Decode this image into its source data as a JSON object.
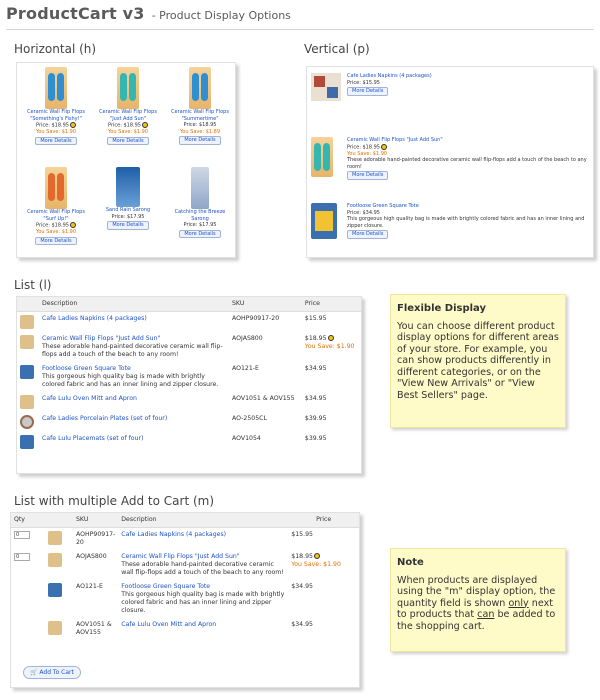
{
  "header": {
    "title": "ProductCart v3",
    "subtitle": "- Product Display Options"
  },
  "sections": {
    "horizontal": "Horizontal (h)",
    "vertical": "Vertical (p)",
    "list": "List (l)",
    "multi": "List with multiple Add to Cart (m)"
  },
  "horizontal": {
    "items": [
      {
        "name": "Ceramic Wall Flip Flops \"Something's Fishy!\"",
        "price": "Price: $18.95",
        "save": "You Save: $1.90",
        "more": "More Details"
      },
      {
        "name": "Ceramic Wall Flip Flops \"Just Add Sun\"",
        "price": "Price: $18.95",
        "save": "You Save: $1.90",
        "more": "More Details"
      },
      {
        "name": "Ceramic Wall Flip Flops \"Summertime\"",
        "price": "Price: $18.95",
        "save": "You Save: $1.89",
        "more": "More Details"
      },
      {
        "name": "Ceramic Wall Flip Flops \"Surf Up!\"",
        "price": "Price: $18.95",
        "save": "You Save: $1.90",
        "more": "More Details"
      },
      {
        "name": "Sand Rain Sarong",
        "price": "Price: $17.95",
        "save": "",
        "more": "More Details"
      },
      {
        "name": "Catching the Breeze Sarong",
        "price": "Price: $17.95",
        "save": "",
        "more": "More Details"
      }
    ]
  },
  "vertical": {
    "items": [
      {
        "name": "Cafe Ladies Napkins (4 packages)",
        "price": "Price: $15.95",
        "save": "",
        "desc": "",
        "more": "More Details"
      },
      {
        "name": "Ceramic Wall Flip Flops \"Just Add Sun\"",
        "price": "Price: $18.95",
        "save": "You Save: $1.90",
        "desc": "These adorable hand-painted decorative ceramic wall flip-flops add a touch of the beach to any room!",
        "more": "More Details"
      },
      {
        "name": "Footloose Green Square Tote",
        "price": "Price: $34.95",
        "save": "",
        "desc": "This gorgeous high quality bag is made with brightly colored fabric and has an inner lining and zipper closure.",
        "more": "More Details"
      }
    ]
  },
  "list": {
    "headers": {
      "description": "Description",
      "sku": "SKU",
      "price": "Price"
    },
    "rows": [
      {
        "name": "Cafe Ladies Napkins (4 packages)",
        "desc": "",
        "sku": "AOHP90917-20",
        "price": "$15.95",
        "save": ""
      },
      {
        "name": "Ceramic Wall Flip Flops \"Just Add Sun\"",
        "desc": "These adorable hand-painted decorative ceramic wall flip-flops add a touch of the beach to any room!",
        "sku": "AOJAS800",
        "price": "$18.95",
        "save": "You Save: $1.90"
      },
      {
        "name": "Footloose Green Square Tote",
        "desc": "This gorgeous high quality bag is made with brightly colored fabric and has an inner lining and zipper closure.",
        "sku": "AO121-E",
        "price": "$34.95",
        "save": ""
      },
      {
        "name": "Cafe Lulu Oven Mitt and Apron",
        "desc": "",
        "sku": "AOV1051 & AOV155",
        "price": "$34.95",
        "save": ""
      },
      {
        "name": "Cafe Ladies Porcelain Plates (set of four)",
        "desc": "",
        "sku": "AO-2505CL",
        "price": "$39.95",
        "save": ""
      },
      {
        "name": "Cafe Lulu Placemats (set of four)",
        "desc": "",
        "sku": "AOV1054",
        "price": "$39.95",
        "save": ""
      }
    ]
  },
  "multi": {
    "headers": {
      "qty": "Qty",
      "sku": "SKU",
      "description": "Description",
      "price": "Price"
    },
    "rows": [
      {
        "qty": "0",
        "sku": "AOHP90917-20",
        "name": "Cafe Ladies Napkins (4 packages)",
        "desc": "",
        "price": "$15.95",
        "save": ""
      },
      {
        "qty": "0",
        "sku": "AOJAS800",
        "name": "Ceramic Wall Flip Flops \"Just Add Sun\"",
        "desc": "These adorable hand-painted decorative ceramic wall flip-flops add a touch of the beach to any room!",
        "price": "$18.95",
        "save": "You Save: $1.90"
      },
      {
        "qty": "",
        "sku": "AO121-E",
        "name": "Footloose Green Square Tote",
        "desc": "This gorgeous high quality bag is made with brightly colored fabric and has an inner lining and zipper closure.",
        "price": "$34.95",
        "save": ""
      },
      {
        "qty": "",
        "sku": "AOV1051 & AOV155",
        "name": "Cafe Lulu Oven Mitt and Apron",
        "desc": "",
        "price": "$34.95",
        "save": ""
      }
    ],
    "add_to_cart": "Add To Cart"
  },
  "notes": {
    "flexible": {
      "title": "Flexible Display",
      "body": "You can choose different product display options for different areas of your store. For example, you can show products differently in different categories, or on the \"View New Arrivals\" or \"View Best Sellers\" page."
    },
    "note": {
      "title": "Note",
      "pre": "When products are displayed using the \"m\" display option, the quantity field is shown ",
      "only": "only",
      "mid": " next to products that ",
      "can": "can",
      "post": " be added to the shopping cart."
    }
  },
  "colors": {
    "link": "#1d52c7",
    "save": "#e07000",
    "note_bg": "#fffbc8",
    "title": "#5a5a5a"
  }
}
